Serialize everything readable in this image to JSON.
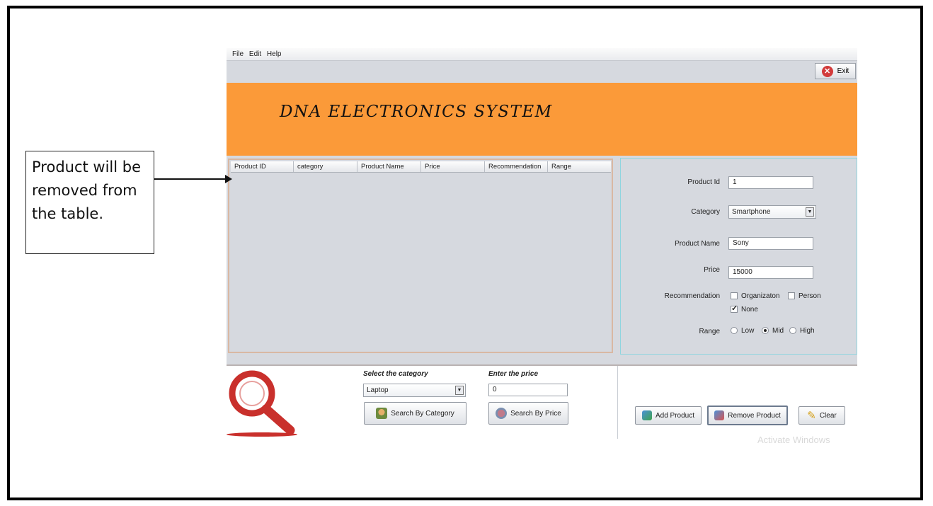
{
  "menu": [
    "File",
    "Edit",
    "Help"
  ],
  "exit_label": "Exit",
  "banner_title": "DNA ELECTRONICS SYSTEM",
  "table": {
    "columns": [
      "Product ID",
      "category",
      "Product Name",
      "Price",
      "Recommendation",
      "Range"
    ]
  },
  "form": {
    "product_id_label": "Product Id",
    "product_id_value": "1",
    "category_label": "Category",
    "category_value": "Smartphone",
    "product_name_label": "Product Name",
    "product_name_value": "Sony",
    "price_label": "Price",
    "price_value": "15000",
    "recommendation_label": "Recommendation",
    "recommendation_options": [
      {
        "label": "Organizaton",
        "checked": false
      },
      {
        "label": "Person",
        "checked": false
      },
      {
        "label": "None",
        "checked": true
      }
    ],
    "range_label": "Range",
    "range_options": [
      {
        "label": "Low",
        "selected": false
      },
      {
        "label": "Mid",
        "selected": true
      },
      {
        "label": "High",
        "selected": false
      }
    ]
  },
  "search": {
    "category_heading": "Select the category",
    "category_value": "Laptop",
    "search_category_button": "Search By Category",
    "price_heading": "Enter the price",
    "price_value": "0",
    "search_price_button": "Search By Price"
  },
  "actions": {
    "add_button": "Add Product",
    "remove_button": "Remove Product",
    "clear_button": "Clear"
  },
  "watermark": "Activate Windows",
  "annotation": {
    "text": "Product will be removed from the table."
  },
  "colors": {
    "banner": "#fb9a39",
    "panel": "#d6d9df",
    "exit_icon": "#d23b3b",
    "logo": "#c9302c"
  }
}
